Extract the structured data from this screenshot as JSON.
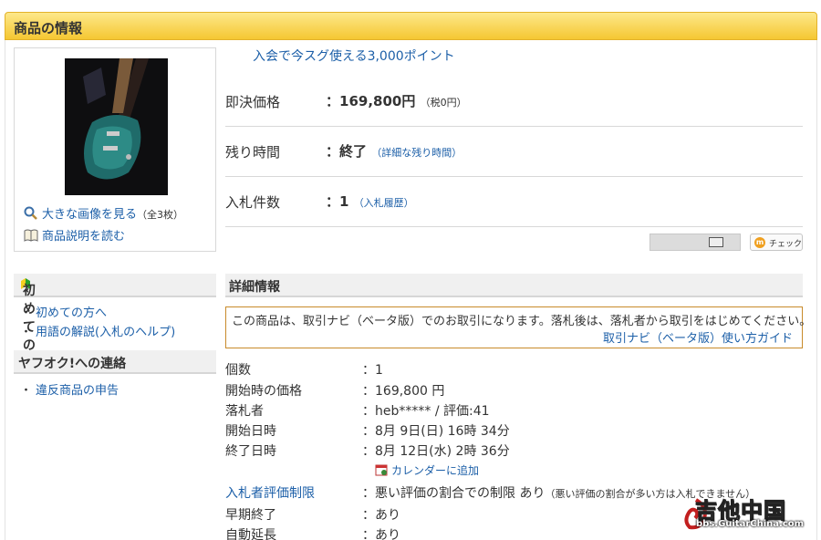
{
  "header": {
    "title": "商品の情報"
  },
  "image_box": {
    "enlarge_label": "大きな画像を見る",
    "enlarge_count": "（全3枚）",
    "description_label": "商品説明を読む"
  },
  "points_banner": "入会で今スグ使える3,000ポイント",
  "price": {
    "buyout_label": "即決価格",
    "buyout_value": "169,800円",
    "buyout_tax": "（税0円）",
    "remaining_label": "残り時間",
    "remaining_value": "終了",
    "remaining_link": "（詳細な残り時間）",
    "bids_label": "入札件数",
    "bids_value": "1",
    "bids_link": "（入札履歴）"
  },
  "actions": {
    "check_label": "チェック"
  },
  "sidebar": {
    "beginner_title": "初めての方",
    "beginner_items": [
      "初めての方へ",
      "用語の解説(入札のヘルプ)"
    ],
    "contact_title": "ヤフオク!への連絡",
    "contact_items": [
      "違反商品の申告"
    ]
  },
  "details": {
    "title": "詳細情報",
    "notice_text": "この商品は、取引ナビ（ベータ版）でのお取引になります。落札後は、落札者から取引をはじめてください。",
    "notice_link": "取引ナビ（ベータ版）使い方ガイド",
    "rows": [
      {
        "label": "個数",
        "value": "：1"
      },
      {
        "label": "開始時の価格",
        "value": "：169,800 円"
      },
      {
        "label": "落札者",
        "value": "：heb***** / 評価:41"
      },
      {
        "label": "開始日時",
        "value": "：8月 9日(日) 16時 34分"
      },
      {
        "label": "終了日時",
        "value": "：8月 12日(水) 2時 36分"
      }
    ],
    "calendar_link": "カレンダーに追加",
    "restriction_label": "入札者評価制限",
    "restriction_value": "：悪い評価の割合での制限 あり",
    "restriction_note": "（悪い評価の割合が多い方は入札できません）",
    "early_end_label": "早期終了",
    "early_end_value": "：あり",
    "auto_extend_label": "自動延長",
    "auto_extend_value": "：あり"
  },
  "watermark": {
    "title": "吉他中国",
    "url": "bbs.GuitarChina.com"
  }
}
